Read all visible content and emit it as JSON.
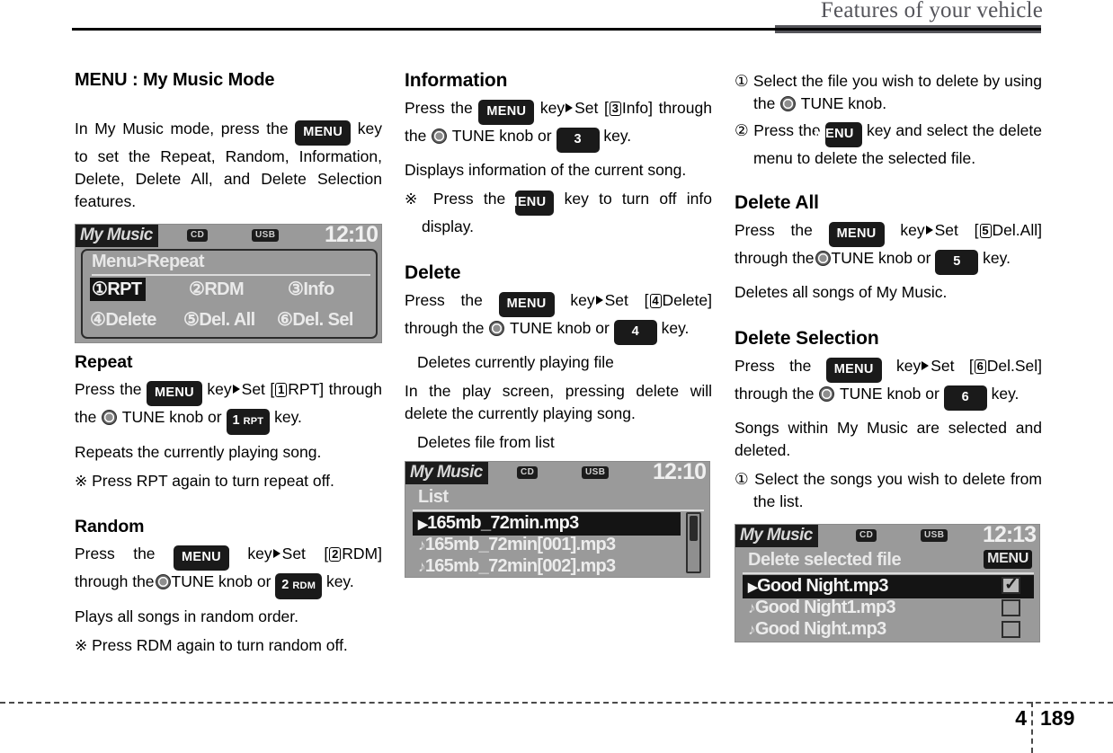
{
  "header": {
    "title": "Features of your vehicle"
  },
  "footer": {
    "chapter": "4",
    "page": "189"
  },
  "col1": {
    "title": "MENU : My Music Mode",
    "intro_a": "In My Music mode, press the",
    "intro_menu": "MENU",
    "intro_b": "key to set the Repeat, Random, Information, Delete, Delete All, and Delete Selection features.",
    "lcd1": {
      "source": "My Music",
      "cd": "CD",
      "usb": "USB",
      "clock": "12:10",
      "breadcrumb": "Menu>Repeat",
      "items": [
        {
          "num": "①",
          "label": "RPT",
          "highlighted": true
        },
        {
          "num": "②",
          "label": "RDM",
          "highlighted": false
        },
        {
          "num": "③",
          "label": "Info",
          "highlighted": false
        },
        {
          "num": "④",
          "label": "Delete",
          "highlighted": false
        },
        {
          "num": "⑤",
          "label": "Del. All",
          "highlighted": false
        },
        {
          "num": "⑥",
          "label": "Del. Sel",
          "highlighted": false
        }
      ]
    },
    "repeat": {
      "heading": "Repeat",
      "p1_a": "Press the",
      "p1_menu": "MENU",
      "p1_b": "key",
      "p1_set": "Set [",
      "p1_cnum": "1",
      "p1_c": "RPT]",
      "p1_d": "through the",
      "p1_e": "TUNE knob or",
      "p1_key_num": "1",
      "p1_key_lbl": "RPT",
      "p1_f": "key.",
      "p2": "Repeats the currently playing song.",
      "p3_mark": "※",
      "p3": "Press RPT again to turn repeat off."
    },
    "random": {
      "heading": "Random",
      "p1_a": "Press the",
      "p1_menu": "MENU",
      "p1_b": "key",
      "p1_set": "Set [",
      "p1_cnum": "2",
      "p1_c": "RDM]",
      "p1_d": "through the",
      "p1_e": "TUNE knob or",
      "p1_key_num": "2",
      "p1_key_lbl": "RDM",
      "p1_f": "key.",
      "p2": "Plays all songs in random order.",
      "p3_mark": "※",
      "p3": "Press RDM again to turn random off."
    }
  },
  "col2": {
    "information": {
      "heading": "Information",
      "p1_a": "Press the",
      "p1_menu": "MENU",
      "p1_b": "key",
      "p1_set": "Set [",
      "p1_cnum": "3",
      "p1_c": "Info]",
      "p1_d": "through the",
      "p1_e": "TUNE knob or",
      "p1_key": "3",
      "p1_f": "key.",
      "p2": "Displays information of the current song.",
      "p3_mark": "※",
      "p3_a": "Press the",
      "p3_menu": "MENU",
      "p3_b": "key to turn off info display."
    },
    "delete": {
      "heading": "Delete",
      "p1_a": "Press the",
      "p1_menu": "MENU",
      "p1_b": "key",
      "p1_set": "Set [",
      "p1_cnum": "4",
      "p1_c": "Delete]",
      "p1_d": "through the",
      "p1_e": "TUNE knob or",
      "p1_key": "4",
      "p1_f": "key.",
      "p2": "Deletes currently playing file",
      "p3": "In the play screen, pressing delete will delete the currently playing song.",
      "p4": "Deletes file from list"
    },
    "lcd2": {
      "source": "My Music",
      "cd": "CD",
      "usb": "USB",
      "clock": "12:10",
      "breadcrumb": "List",
      "rows": [
        {
          "icon": "▶",
          "label": "165mb_72min.mp3",
          "selected": true
        },
        {
          "icon": "♪",
          "label": "165mb_72min[001].mp3",
          "selected": false
        },
        {
          "icon": "♪",
          "label": "165mb_72min[002].mp3",
          "selected": false
        }
      ]
    }
  },
  "col3": {
    "step1_num": "①",
    "step1_a": "Select the file you wish to delete by using the",
    "step1_b": "TUNE knob.",
    "step2_num": "②",
    "step2_a": "Press the",
    "step2_menu": "MENU",
    "step2_b": "key and select the delete menu to delete the selected file.",
    "delete_all": {
      "heading": "Delete All",
      "p1_a": "Press the",
      "p1_menu": "MENU",
      "p1_b": "key",
      "p1_set": "Set [",
      "p1_cnum": "5",
      "p1_c": "Del.All]",
      "p1_d": "through the",
      "p1_e": "TUNE knob or",
      "p1_key": "5",
      "p1_f": "key.",
      "p2": "Deletes all songs of My Music."
    },
    "delete_selection": {
      "heading": "Delete Selection",
      "p1_a": "Press the",
      "p1_menu": "MENU",
      "p1_b": "key",
      "p1_set": "Set [",
      "p1_cnum": "6",
      "p1_c": "Del.Sel]",
      "p1_d": "through the",
      "p1_e": "TUNE knob or",
      "p1_key": "6",
      "p1_f": "key.",
      "p2": "Songs within My Music are selected and deleted.",
      "step1_num": "①",
      "step1": "Select the songs you wish to delete from the list."
    },
    "lcd3": {
      "source": "My Music",
      "cd": "CD",
      "usb": "USB",
      "clock": "12:13",
      "breadcrumb": "Delete selected file",
      "menu_badge": "MENU",
      "rows": [
        {
          "icon": "▶",
          "label": "Good Night.mp3",
          "selected": true,
          "checked": true
        },
        {
          "icon": "♪",
          "label": "Good Night1.mp3",
          "selected": false,
          "checked": false
        },
        {
          "icon": "♪",
          "label": "Good Night.mp3",
          "selected": false,
          "checked": false
        }
      ]
    }
  }
}
